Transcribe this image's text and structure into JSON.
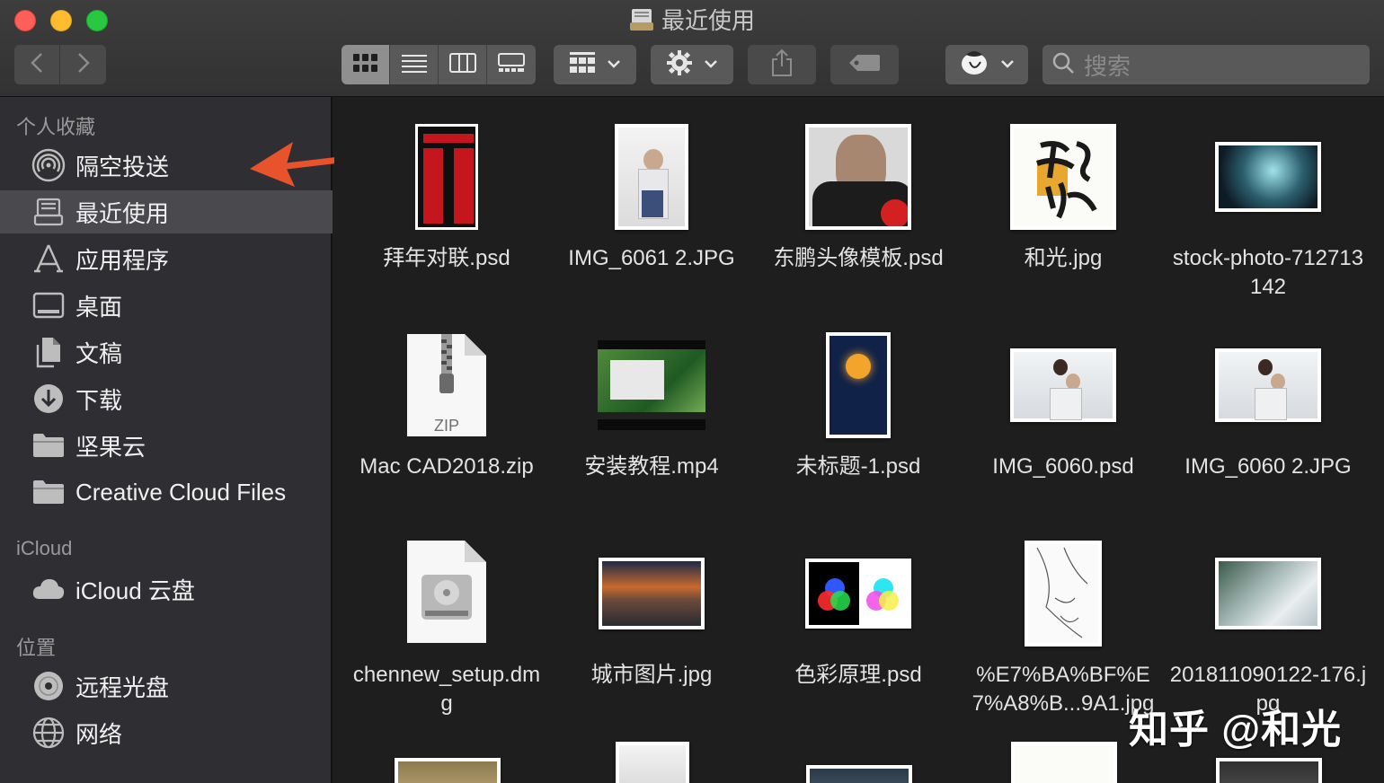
{
  "window": {
    "title": "最近使用",
    "title_icon": "recents-icon"
  },
  "toolbar": {
    "back_icon": "chevron-left-icon",
    "forward_icon": "chevron-right-icon",
    "view_modes": [
      "icon-view",
      "list-view",
      "column-view",
      "gallery-view"
    ],
    "active_view": "icon-view",
    "group_icon": "group-grid-icon",
    "action_icon": "gear-icon",
    "share_icon": "share-icon",
    "tag_icon": "tag-icon",
    "extension_icon": "app-extension-icon",
    "search_placeholder": "搜索"
  },
  "sidebar": {
    "favorites_title": "个人收藏",
    "favorites": [
      {
        "label": "隔空投送",
        "icon": "airdrop-icon"
      },
      {
        "label": "最近使用",
        "icon": "recents-icon",
        "selected": true
      },
      {
        "label": "应用程序",
        "icon": "applications-icon"
      },
      {
        "label": "桌面",
        "icon": "desktop-icon"
      },
      {
        "label": "文稿",
        "icon": "documents-icon"
      },
      {
        "label": "下载",
        "icon": "downloads-icon"
      },
      {
        "label": "坚果云",
        "icon": "folder-icon"
      },
      {
        "label": "Creative Cloud Files",
        "icon": "folder-icon"
      }
    ],
    "icloud_title": "iCloud",
    "icloud": [
      {
        "label": "iCloud 云盘",
        "icon": "cloud-icon"
      }
    ],
    "locations_title": "位置",
    "locations": [
      {
        "label": "远程光盘",
        "icon": "disc-icon"
      },
      {
        "label": "网络",
        "icon": "network-icon"
      }
    ]
  },
  "files": [
    {
      "name": "拜年对联.psd",
      "kind": "couplet"
    },
    {
      "name": "IMG_6061 2.JPG",
      "kind": "portrait-photo"
    },
    {
      "name": "东鹏头像模板.psd",
      "kind": "avatar-template"
    },
    {
      "name": "和光.jpg",
      "kind": "calligraphy"
    },
    {
      "name": "stock-photo-712713142",
      "kind": "landscape-photo"
    },
    {
      "name": "Mac CAD2018.zip",
      "kind": "zip",
      "badge": "ZIP"
    },
    {
      "name": "安装教程.mp4",
      "kind": "video"
    },
    {
      "name": "未标题-1.psd",
      "kind": "night-moon"
    },
    {
      "name": "IMG_6060.psd",
      "kind": "couple-photo"
    },
    {
      "name": "IMG_6060 2.JPG",
      "kind": "couple-photo"
    },
    {
      "name": "chennew_setup.dmg",
      "kind": "dmg"
    },
    {
      "name": "城市图片.jpg",
      "kind": "city-photo"
    },
    {
      "name": "色彩原理.psd",
      "kind": "color-theory"
    },
    {
      "name": "%E7%BA%BF%E7%A8%B...9A1.jpg",
      "kind": "sketch"
    },
    {
      "name": "201811090122-176.jpg",
      "kind": "sky-photo"
    }
  ],
  "watermark": "知乎 @和光"
}
